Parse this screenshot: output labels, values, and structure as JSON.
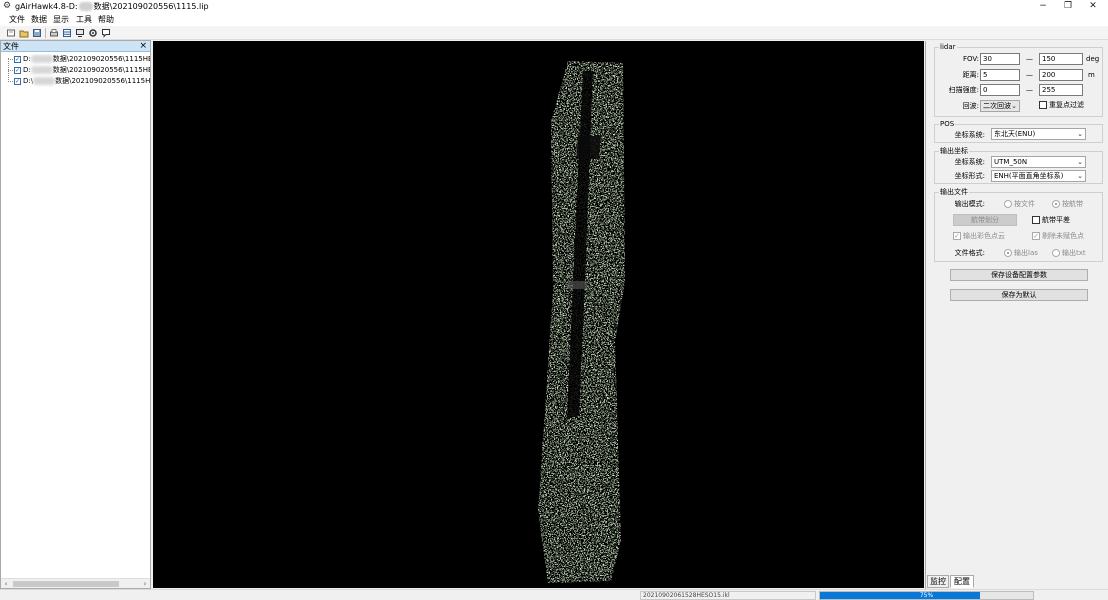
{
  "window": {
    "title_prefix": "gAirHawk4.8-D:",
    "title_suffix": "数据\\202109020556\\1115.lip",
    "minimize_glyph": "−",
    "maximize_glyph": "❐",
    "close_glyph": "✕"
  },
  "menu": [
    "文件",
    "数据",
    "显示",
    "工具",
    "帮助"
  ],
  "file_panel": {
    "title": "文件",
    "close_glyph": "×",
    "items": [
      {
        "prefix": "D:",
        "suffix": "数据\\202109020556\\1115HESLi",
        "checked": true
      },
      {
        "prefix": "D:",
        "suffix": "数据\\202109020556\\1115HESLi",
        "checked": true
      },
      {
        "prefix": "D:\\",
        "suffix": "数据\\202109020556\\1115HESLi",
        "checked": true
      }
    ]
  },
  "config": {
    "lidar": {
      "title": "lidar",
      "fov_label": "FOV:",
      "fov_min": "30",
      "fov_max": "150",
      "fov_unit": "deg",
      "range_label": "距离:",
      "range_min": "5",
      "range_max": "200",
      "range_unit": "m",
      "intensity_label": "扫描强度:",
      "intensity_min": "0",
      "intensity_max": "255",
      "dash": "—",
      "echo_label": "回波:",
      "echo_value": "二次回波",
      "dup_filter_label": "重复点过滤",
      "dup_filter_checked": false
    },
    "pos": {
      "title": "POS",
      "coord_label": "坐标系统:",
      "coord_value": "东北天(ENU)"
    },
    "output_coord": {
      "title": "输出坐标",
      "coord_label": "坐标系统:",
      "coord_value": "UTM_50N",
      "format_label": "坐标形式:",
      "format_value": "ENH(平面直角坐标系)"
    },
    "output_file": {
      "title": "输出文件",
      "mode_label": "输出模式:",
      "mode_by_file": "按文件",
      "mode_by_route": "按航带",
      "mode_selected": "按航带",
      "split_button": "航带划分",
      "band_level_label": "航带平差",
      "band_level_checked": false,
      "color_points_label": "输出彩色点云",
      "color_points_checked": true,
      "remove_uncolored_label": "剔除未赋色点",
      "remove_uncolored_checked": true,
      "format_label": "文件格式:",
      "format_las": "输出las",
      "format_txt": "输出txt",
      "format_selected": "输出las"
    },
    "save_device_button": "保存设备配置参数",
    "save_default_button": "保存为默认"
  },
  "tabs": [
    "监控",
    "配置"
  ],
  "active_tab": "配置",
  "status": {
    "file": "20210902061528HESO15.ikl",
    "progress_text": "75%",
    "progress": 0.75,
    "accent": "#0a78d7"
  },
  "icons": [
    "gear-icon",
    "new-file-icon",
    "open-folder-icon",
    "save-icon",
    "print-icon",
    "grid-icon",
    "monitor-icon",
    "settings-icon",
    "comment-icon"
  ]
}
